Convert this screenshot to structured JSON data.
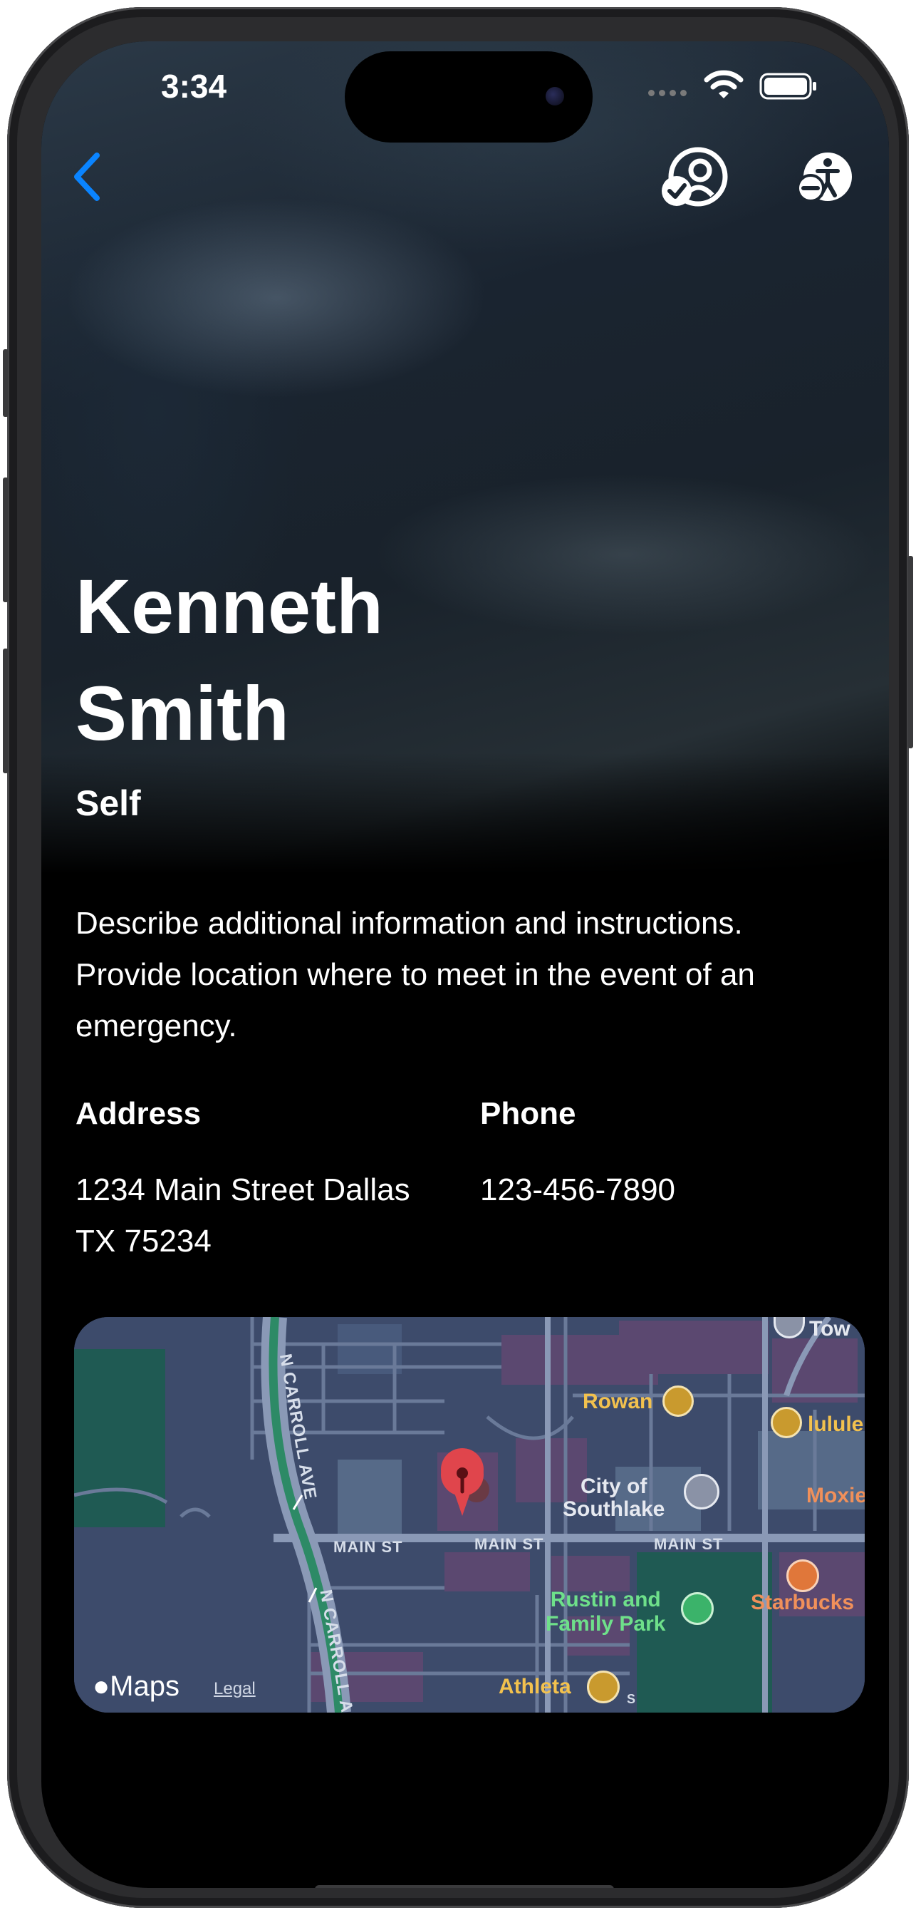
{
  "status_bar": {
    "time": "3:34"
  },
  "icons": {
    "back": "chevron-left-icon",
    "contact": "person-checkmark-icon",
    "accessibility": "accessibility-icon",
    "wifi": "wifi-icon",
    "battery": "battery-icon",
    "pin": "map-pin-icon"
  },
  "colors": {
    "accent": "#0a84ff",
    "background": "#000000",
    "pin": "#e0454c"
  },
  "contact": {
    "first_name": "Kenneth",
    "last_name": "Smith",
    "relation": "Self",
    "description": "Describe additional information and instructions. Provide location where to meet in the event of an emergency.",
    "address_label": "Address",
    "address_line1": "1234 Main Street Dallas",
    "address_line2": "TX 75234",
    "phone_label": "Phone",
    "phone": "123-456-7890"
  },
  "map": {
    "brand": "Maps",
    "legal": "Legal",
    "streets": {
      "n_carroll_1": "N CARROLL AVE",
      "n_carroll_2": "N CARROLL A",
      "main_st_1": "MAIN ST",
      "main_st_2": "MAIN ST",
      "main_st_3": "MAIN ST",
      "s_label": "S"
    },
    "pois": {
      "rowan": "Rowan",
      "city_hall_1": "City of",
      "city_hall_2": "Southlake",
      "lulu": "lulule",
      "moxie": "Moxie",
      "town": "Tow",
      "park_1": "Rustin and",
      "park_2": "Family Park",
      "starbucks": "Starbucks",
      "athleta": "Athleta"
    }
  }
}
